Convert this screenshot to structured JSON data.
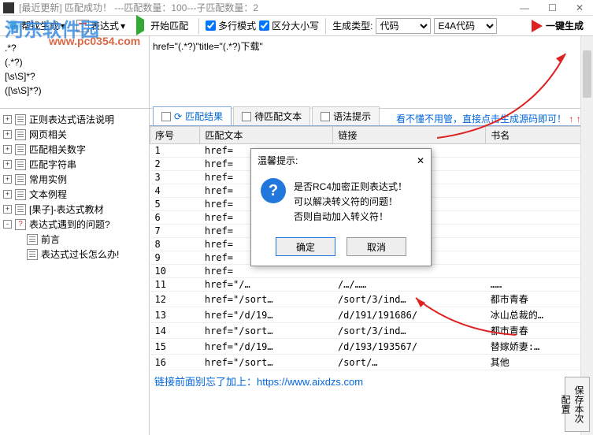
{
  "title": "[最近更新]  匹配成功！ ---匹配数量：100---子匹配数量：2",
  "watermark": "河东软件园",
  "watermark2": "www.pc0354.com",
  "toolbar": {
    "help": "帮找生成",
    "expr": "表达式",
    "start": "开始匹配",
    "multiline": "多行模式",
    "case": "区分大小写",
    "gentype_label": "生成类型:",
    "gentype": "代码",
    "fmt": "E4A代码",
    "gen": "一键生成"
  },
  "patterns": [
    ".*?",
    "(.*?)",
    "[\\s\\S]*?",
    "([\\s\\S]*?)"
  ],
  "regex_display": "href=\"(.*?)\"title=\"(.*?)下载\"",
  "tree": [
    {
      "exp": "+",
      "label": "正则表达式语法说明"
    },
    {
      "exp": "+",
      "label": "网页相关"
    },
    {
      "exp": "+",
      "label": "匹配相关数字"
    },
    {
      "exp": "+",
      "label": "匹配字符串"
    },
    {
      "exp": "+",
      "label": "常用实例"
    },
    {
      "exp": "+",
      "label": "文本例程"
    },
    {
      "exp": "+",
      "label": "[果子]-表达式教材"
    },
    {
      "exp": "-",
      "label": "表达式遇到的问题?",
      "q": true,
      "children": [
        {
          "label": "前言"
        },
        {
          "label": "表达式过长怎么办!"
        }
      ]
    }
  ],
  "tabs": [
    {
      "label": "语法提示"
    },
    {
      "label": "待匹配文本"
    },
    {
      "label": "匹配结果",
      "active": true
    }
  ],
  "hint_text": "看不懂不用管，直接点击生成源码即可！",
  "hint_arrows": "↑ ↑ ↑",
  "columns": [
    "序号",
    "匹配文本",
    "链接",
    "书名"
  ],
  "rows": [
    {
      "n": 1,
      "t": "href=",
      "l": "",
      "b": ""
    },
    {
      "n": 2,
      "t": "href=",
      "l": "",
      "b": ""
    },
    {
      "n": 3,
      "t": "href=",
      "l": "",
      "b": ""
    },
    {
      "n": 4,
      "t": "href=",
      "l": "",
      "b": ""
    },
    {
      "n": 5,
      "t": "href=",
      "l": "",
      "b": ""
    },
    {
      "n": 6,
      "t": "href=",
      "l": "",
      "b": ""
    },
    {
      "n": 7,
      "t": "href=",
      "l": "",
      "b": ""
    },
    {
      "n": 8,
      "t": "href=",
      "l": "",
      "b": ""
    },
    {
      "n": 9,
      "t": "href=",
      "l": "",
      "b": ""
    },
    {
      "n": 10,
      "t": "href=",
      "l": "",
      "b": ""
    },
    {
      "n": 11,
      "t": "href=\"/…",
      "l": "/…/……",
      "b": "……"
    },
    {
      "n": 12,
      "t": "href=\"/sort…",
      "l": "/sort/3/ind…",
      "b": "都市青春"
    },
    {
      "n": 13,
      "t": "href=\"/d/19…",
      "l": "/d/191/191686/",
      "b": "冰山总裁的…"
    },
    {
      "n": 14,
      "t": "href=\"/sort…",
      "l": "/sort/3/ind…",
      "b": "都市青春"
    },
    {
      "n": 15,
      "t": "href=\"/d/19…",
      "l": "/d/193/193567/",
      "b": "替嫁娇妻:…"
    },
    {
      "n": 16,
      "t": "href=\"/sort…",
      "l": "/sort/…",
      "b": "其他"
    }
  ],
  "footer": "链接前面别忘了加上：https://www.aixdzs.com",
  "savebox": "保存本次配置",
  "dialog": {
    "title": "温馨提示:",
    "close": "✕",
    "lines": [
      "是否RC4加密正则表达式！",
      "可以解决转义符的问题！",
      "否则自动加入转义符！"
    ],
    "ok": "确定",
    "cancel": "取消"
  }
}
